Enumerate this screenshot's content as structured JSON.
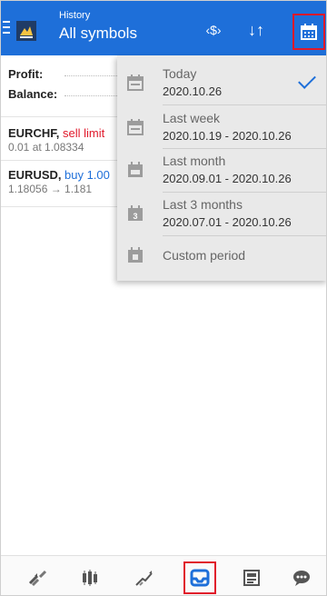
{
  "header": {
    "subtitle": "History",
    "title": "All symbols",
    "buttons": {
      "currency_icon": "currency-filter-icon",
      "sort_icon": "sort-icon",
      "calendar_icon": "calendar-icon"
    }
  },
  "summary": {
    "profit_label": "Profit:",
    "balance_label": "Balance:"
  },
  "deals": [
    {
      "symbol": "EURCHF,",
      "type": "sell limit",
      "type_color": "#e0192b",
      "detail": "0.01 at 1.08334"
    },
    {
      "symbol": "EURUSD,",
      "type": "buy 1.00",
      "type_color": "#1e6fd9",
      "detail": "1.18056 → 1.181"
    }
  ],
  "period_menu": {
    "items": [
      {
        "label": "Today",
        "range": "2020.10.26",
        "selected": true
      },
      {
        "label": "Last week",
        "range": "2020.10.19 - 2020.10.26",
        "selected": false
      },
      {
        "label": "Last month",
        "range": "2020.09.01 - 2020.10.26",
        "selected": false
      },
      {
        "label": "Last 3 months",
        "range": "2020.07.01 - 2020.10.26",
        "selected": false
      },
      {
        "label": "Custom period",
        "range": "",
        "selected": false
      }
    ]
  },
  "bottom_nav": {
    "items": [
      {
        "icon": "quotes-icon"
      },
      {
        "icon": "chart-icon"
      },
      {
        "icon": "trade-icon"
      },
      {
        "icon": "history-icon",
        "active": true
      },
      {
        "icon": "news-icon"
      },
      {
        "icon": "messages-icon"
      }
    ]
  },
  "colors": {
    "accent": "#1e6fd9",
    "highlight_border": "#e0192b",
    "sell": "#e0192b",
    "buy": "#1e6fd9"
  }
}
